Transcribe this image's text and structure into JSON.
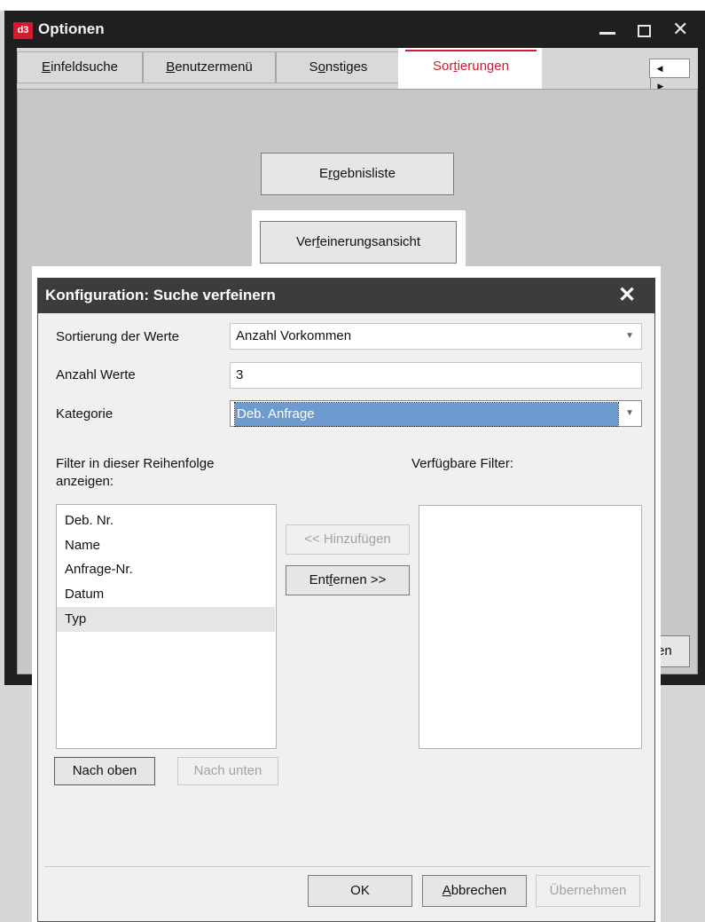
{
  "window": {
    "logo": "d3",
    "title": "Optionen"
  },
  "tabs": [
    {
      "label": "Einfeldsuche",
      "mnemonic": "E",
      "rest": "infeldsuche"
    },
    {
      "label": "Benutzermenü",
      "mnemonic": "B",
      "rest": "enutzermenü"
    },
    {
      "label": "Sonstiges",
      "pre": "S",
      "mnemonic": "o",
      "rest": "nstiges"
    },
    {
      "label": "Sortierungen",
      "pre": "Sor",
      "mnemonic": "t",
      "rest": "ierungen",
      "active": true
    }
  ],
  "options_content": {
    "ergebnisliste": {
      "pre": "E",
      "mnemonic": "r",
      "rest": "gebnisliste"
    },
    "verfeinerungsansicht": {
      "pre": "Ver",
      "mnemonic": "f",
      "rest": "einerungsansicht"
    },
    "partial_button_text": "en"
  },
  "dialog": {
    "title": "Konfiguration: Suche verfeinern",
    "close_glyph": "✕",
    "sort_label": "Sortierung der Werte",
    "sort_value": "Anzahl Vorkommen",
    "count_label": "Anzahl Werte",
    "count_value": "3",
    "category_label": "Kategorie",
    "category_value": "Deb. Anfrage",
    "order_label_line1": "Filter in dieser Reihenfolge",
    "order_label_line2": "anzeigen:",
    "available_label": "Verfügbare Filter:",
    "order_items": [
      "Deb. Nr.",
      "Name",
      "Anfrage-Nr.",
      "Datum",
      "Typ"
    ],
    "selected_item_index": 4,
    "available_items": [],
    "add_button": "<< Hinzufügen",
    "remove_button": {
      "pre": "Ent",
      "mnemonic": "f",
      "rest": "ernen >>"
    },
    "up_button": "Nach oben",
    "down_button": "Nach unten",
    "ok_button": "OK",
    "cancel_button": {
      "mnemonic": "A",
      "rest": "bbrechen"
    },
    "apply_button": "Übernehmen"
  },
  "colors": {
    "accent": "#d9182d",
    "titlebar": "#1f1f1f",
    "dialog_titlebar": "#3c3c3c",
    "selection": "#6d9bd0"
  },
  "icons": {
    "minimize": "minimize-icon",
    "maximize": "maximize-icon",
    "close": "close-icon",
    "dropdown": "chevron-down-icon",
    "scroll_left": "arrow-left-icon",
    "scroll_right": "arrow-right-icon"
  }
}
